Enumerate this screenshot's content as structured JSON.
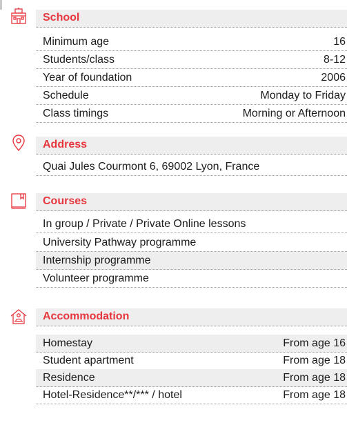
{
  "colors": {
    "accent": "#e8363e",
    "band": "#eeeeee",
    "text": "#1c1c1c"
  },
  "school": {
    "icon": "school-building-icon",
    "title": "School",
    "rows": [
      {
        "label": "Minimum age",
        "value": "16"
      },
      {
        "label": "Students/class",
        "value": "8-12"
      },
      {
        "label": "Year of foundation",
        "value": "2006"
      },
      {
        "label": "Schedule",
        "value": "Monday to Friday"
      },
      {
        "label": "Class timings",
        "value": "Morning or Afternoon"
      }
    ]
  },
  "address": {
    "icon": "location-pin-icon",
    "title": "Address",
    "text": "Quai Jules Courmont 6, 69002 Lyon, France"
  },
  "courses": {
    "icon": "book-icon",
    "title": "Courses",
    "items": [
      "In group / Private / Private Online lessons",
      "University Pathway programme",
      "Internship programme",
      "Volunteer programme"
    ]
  },
  "accommodation": {
    "icon": "house-icon",
    "title": "Accommodation",
    "rows": [
      {
        "label": "Homestay",
        "value": "From age 16"
      },
      {
        "label": "Student apartment",
        "value": "From age 18"
      },
      {
        "label": "Residence",
        "value": "From age 18"
      },
      {
        "label": "Hotel-Residence**/*** / hotel",
        "value": "From age 18"
      }
    ]
  }
}
